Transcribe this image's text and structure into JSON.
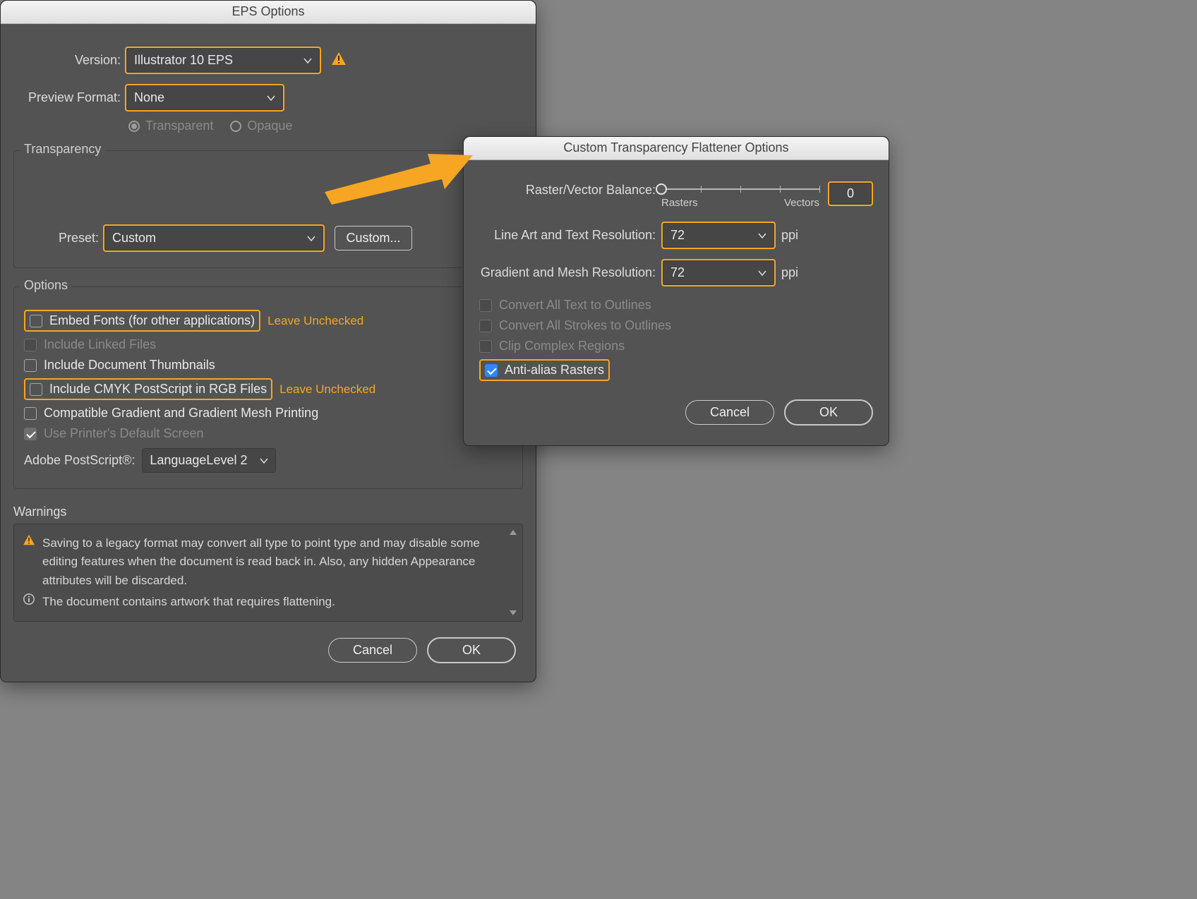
{
  "eps": {
    "title": "EPS Options",
    "version_label": "Version:",
    "version_value": "Illustrator 10 EPS",
    "preview_label": "Preview Format:",
    "preview_value": "None",
    "radio_transparent": "Transparent",
    "radio_opaque": "Opaque",
    "transparency_legend": "Transparency",
    "preset_label": "Preset:",
    "preset_value": "Custom",
    "custom_btn": "Custom...",
    "options_legend": "Options",
    "opt_embed": "Embed Fonts (for other applications)",
    "opt_linked": "Include Linked Files",
    "opt_thumbs": "Include Document Thumbnails",
    "opt_cmyk": "Include CMYK PostScript in RGB Files",
    "opt_compat": "Compatible Gradient and Gradient Mesh Printing",
    "opt_printer": "Use Printer's Default Screen",
    "leave_unchecked": "Leave Unchecked",
    "ps_label": "Adobe PostScript®:",
    "ps_value": "LanguageLevel 2",
    "warnings_label": "Warnings",
    "warn1": "Saving to a legacy format may convert all type to point type and may disable some editing features when the document is read back in. Also, any hidden Appearance attributes will be discarded.",
    "warn2": "The document contains artwork that requires flattening.",
    "cancel": "Cancel",
    "ok": "OK"
  },
  "flat": {
    "title": "Custom Transparency Flattener Options",
    "balance_label": "Raster/Vector Balance:",
    "balance_value": "0",
    "rasters": "Rasters",
    "vectors": "Vectors",
    "lineart_label": "Line Art and Text Resolution:",
    "lineart_value": "72",
    "mesh_label": "Gradient and Mesh Resolution:",
    "mesh_value": "72",
    "ppi": "ppi",
    "cb_text": "Convert All Text to Outlines",
    "cb_strokes": "Convert All Strokes to Outlines",
    "cb_clip": "Clip Complex Regions",
    "cb_aa": "Anti-alias Rasters",
    "cancel": "Cancel",
    "ok": "OK"
  }
}
